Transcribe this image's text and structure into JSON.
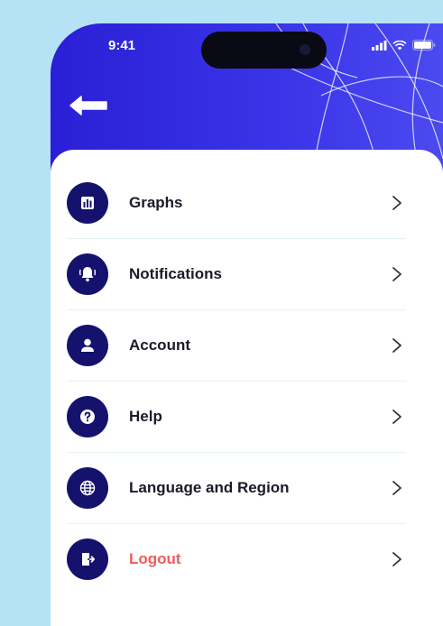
{
  "status_bar": {
    "time": "9:41"
  },
  "header": {
    "back_icon": "arrow-left-icon"
  },
  "menu": {
    "items": [
      {
        "label": "Graphs",
        "icon": "bar-chart-icon"
      },
      {
        "label": "Notifications",
        "icon": "bell-icon"
      },
      {
        "label": "Account",
        "icon": "user-icon"
      },
      {
        "label": "Help",
        "icon": "question-icon"
      },
      {
        "label": "Language and Region",
        "icon": "globe-icon"
      },
      {
        "label": "Logout",
        "icon": "logout-icon"
      }
    ]
  },
  "colors": {
    "header": "#2f2be0",
    "icon_bg": "#15126e",
    "logout_text": "#ee5d5d",
    "background": "#b5e2f5"
  }
}
